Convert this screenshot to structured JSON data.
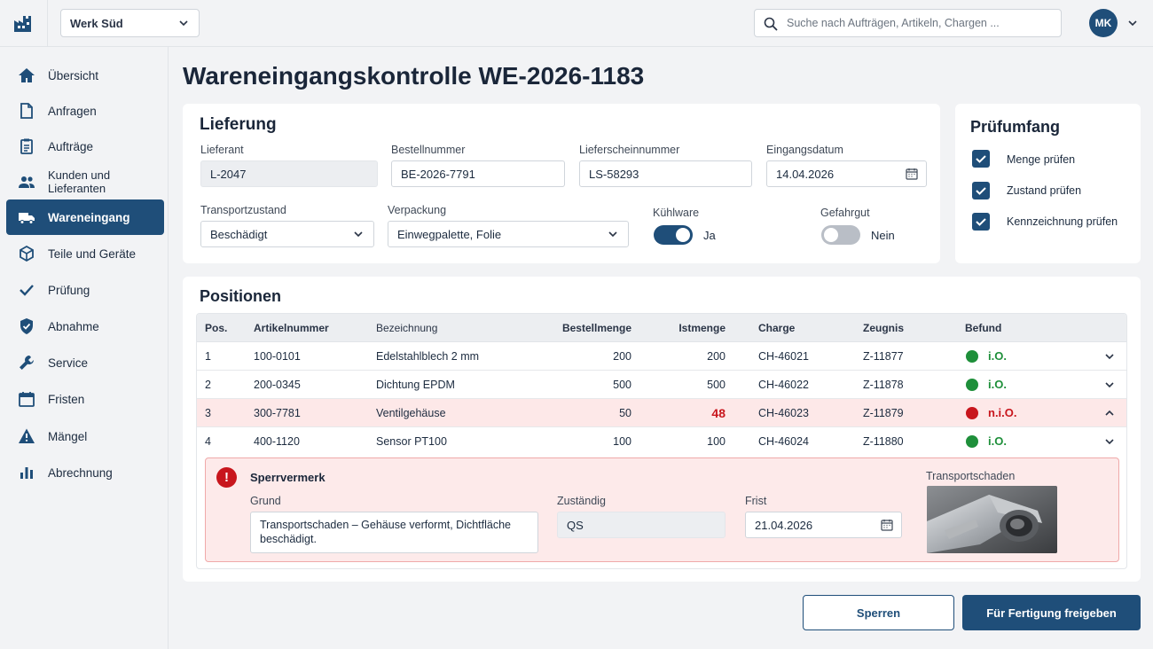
{
  "header": {
    "plant_select": "Werk Süd",
    "search_placeholder": "Suche nach Aufträgen, Artikeln, Chargen ...",
    "user_initials": "MK"
  },
  "sidebar": {
    "items": [
      {
        "label": "Übersicht",
        "icon": "home-icon"
      },
      {
        "label": "Anfragen",
        "icon": "document-icon"
      },
      {
        "label": "Aufträge",
        "icon": "clipboard-icon"
      },
      {
        "label": "Kunden und Lieferanten",
        "icon": "people-icon"
      },
      {
        "label": "Wareneingang",
        "icon": "truck-icon",
        "active": true
      },
      {
        "label": "Teile und Geräte",
        "icon": "box-icon"
      },
      {
        "label": "Prüfung",
        "icon": "check-icon"
      },
      {
        "label": "Abnahme",
        "icon": "shield-check-icon"
      },
      {
        "label": "Service",
        "icon": "wrench-icon"
      },
      {
        "label": "Fristen",
        "icon": "calendar-icon"
      },
      {
        "label": "Mängel",
        "icon": "warning-icon"
      },
      {
        "label": "Abrechnung",
        "icon": "bar-chart-icon"
      }
    ]
  },
  "page": {
    "title": "Wareneingangskontrolle WE-2026-1183"
  },
  "lieferung": {
    "title": "Lieferung",
    "lieferant_label": "Lieferant",
    "lieferant": "L-2047",
    "bestellnummer_label": "Bestellnummer",
    "bestellnummer": "BE-2026-7791",
    "lieferschein_label": "Lieferscheinnummer",
    "lieferschein": "LS-58293",
    "eingangsdatum_label": "Eingangsdatum",
    "eingangsdatum": "14.04.2026",
    "transportzustand_label": "Transportzustand",
    "transportzustand": "Beschädigt",
    "verpackung_label": "Verpackung",
    "verpackung": "Einwegpalette, Folie",
    "kuehlware_label": "Kühlware",
    "kuehlware_value": "Ja",
    "kuehlware_on": true,
    "gefahrgut_label": "Gefahrgut",
    "gefahrgut_value": "Nein",
    "gefahrgut_on": false
  },
  "pruefumfang": {
    "title": "Prüfumfang",
    "items": [
      {
        "label": "Menge prüfen",
        "checked": true
      },
      {
        "label": "Zustand prüfen",
        "checked": true
      },
      {
        "label": "Kennzeichnung prüfen",
        "checked": true
      }
    ]
  },
  "positionen": {
    "title": "Positionen",
    "headers": {
      "pos": "Pos.",
      "artikel": "Artikelnummer",
      "bezeichnung": "Bezeichnung",
      "bestellmenge": "Bestellmenge",
      "istmenge": "Istmenge",
      "charge": "Charge",
      "zeugnis": "Zeugnis",
      "befund": "Befund"
    },
    "rows": [
      {
        "pos": "1",
        "artikel": "100-0101",
        "bezeichnung": "Edelstahlblech 2 mm",
        "bestellmenge": "200",
        "istmenge": "200",
        "charge": "CH-46021",
        "zeugnis": "Z-11877",
        "befund": "i.O.",
        "ok": true
      },
      {
        "pos": "2",
        "artikel": "200-0345",
        "bezeichnung": "Dichtung EPDM",
        "bestellmenge": "500",
        "istmenge": "500",
        "charge": "CH-46022",
        "zeugnis": "Z-11878",
        "befund": "i.O.",
        "ok": true
      },
      {
        "pos": "3",
        "artikel": "300-7781",
        "bezeichnung": "Ventilgehäuse",
        "bestellmenge": "50",
        "istmenge": "48",
        "charge": "CH-46023",
        "zeugnis": "Z-11879",
        "befund": "n.i.O.",
        "ok": false
      },
      {
        "pos": "4",
        "artikel": "400-1120",
        "bezeichnung": "Sensor PT100",
        "bestellmenge": "100",
        "istmenge": "100",
        "charge": "CH-46024",
        "zeugnis": "Z-11880",
        "befund": "i.O.",
        "ok": true
      }
    ]
  },
  "sperrvermerk": {
    "title": "Sperrvermerk",
    "grund_label": "Grund",
    "grund": "Transportschaden – Gehäuse verformt, Dichtfläche beschädigt.",
    "zustaendig_label": "Zuständig",
    "zustaendig": "QS",
    "frist_label": "Frist",
    "frist": "21.04.2026",
    "photo_label": "Transportschaden"
  },
  "actions": {
    "sperren": "Sperren",
    "freigeben": "Für Fertigung freigeben"
  },
  "colors": {
    "primary": "#1f4e79",
    "ok": "#1e8f3a",
    "error": "#c8161d",
    "error_bg": "#fde8e8"
  }
}
